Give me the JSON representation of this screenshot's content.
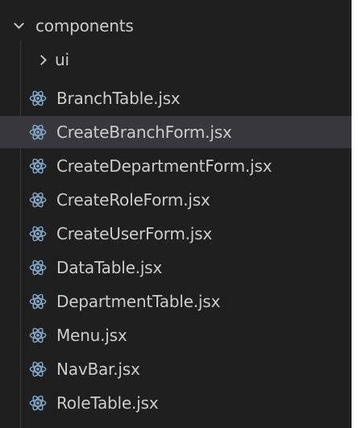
{
  "explorer": {
    "folder": {
      "name": "components",
      "expanded": true
    },
    "subfolder": {
      "name": "ui",
      "expanded": false
    },
    "files": [
      {
        "name": "BranchTable.jsx",
        "icon": "react-icon"
      },
      {
        "name": "CreateBranchForm.jsx",
        "icon": "react-icon",
        "selected": true
      },
      {
        "name": "CreateDepartmentForm.jsx",
        "icon": "react-icon"
      },
      {
        "name": "CreateRoleForm.jsx",
        "icon": "react-icon"
      },
      {
        "name": "CreateUserForm.jsx",
        "icon": "react-icon"
      },
      {
        "name": "DataTable.jsx",
        "icon": "react-icon"
      },
      {
        "name": "DepartmentTable.jsx",
        "icon": "react-icon"
      },
      {
        "name": "Menu.jsx",
        "icon": "react-icon"
      },
      {
        "name": "NavBar.jsx",
        "icon": "react-icon"
      },
      {
        "name": "RoleTable.jsx",
        "icon": "react-icon"
      }
    ]
  },
  "colors": {
    "background": "#1f1f1f",
    "selected_row": "#37373d",
    "text": "#cccccc",
    "react_icon": "#7fa8c9"
  }
}
